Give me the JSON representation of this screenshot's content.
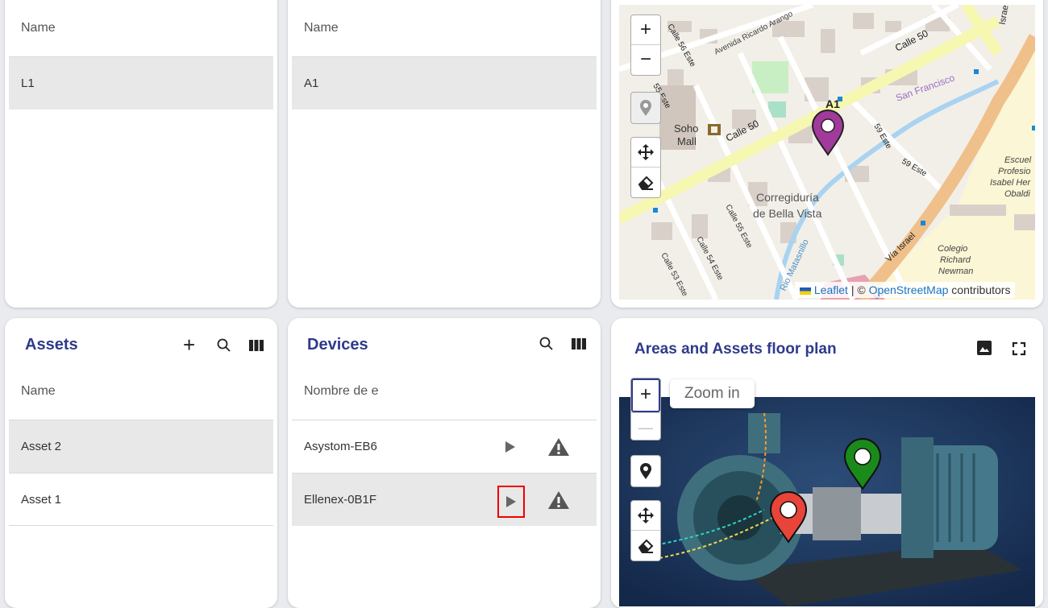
{
  "locations_card": {
    "column_header": "Name",
    "rows": [
      "L1"
    ]
  },
  "areas_card": {
    "column_header": "Name",
    "rows": [
      "A1"
    ]
  },
  "map": {
    "zoom_in": "+",
    "zoom_out": "−",
    "attribution": {
      "leaflet": "Leaflet",
      "separator": " | © ",
      "osm": "OpenStreetMap",
      "suffix": " contributors"
    },
    "labels": {
      "calle50": "Calle 50",
      "calle50_b": "Calle 50",
      "avenida": "Avenida Ricardo Arango",
      "sanfrancisco": "San Francisco",
      "soho": "Soho",
      "mall": "Mall",
      "a1": "A1",
      "correg": "Corregiduría",
      "bella": "de Bella Vista",
      "calle55": "Calle 55 Este",
      "calle54": "Calle 54 Este",
      "calle53": "Calle 53 Este",
      "rio": "Rio Matasnillo",
      "via": "Vía Israel",
      "colegio": "Colegio",
      "richard": "Richard",
      "newman": "Newman",
      "escuel": "Escuel",
      "profesio": "Profesio",
      "isabel": "Isabel Her",
      "obaldi": "Obaldi",
      "e59a": "59 Este",
      "e59b": "59 Este",
      "israel": "Israel",
      "calle56": "Calle 56 Este",
      "e55top": "55 Este",
      "co": "Co"
    },
    "colors": {
      "marker": "#a23a9b",
      "water": "#a9d3f0",
      "road_yellow": "#f6f7b0"
    }
  },
  "assets_card": {
    "title": "Assets",
    "add_icon": "+",
    "column_header": "Name",
    "rows": [
      "Asset 2",
      "Asset 1"
    ]
  },
  "devices_card": {
    "title": "Devices",
    "column_header": "Nombre de e",
    "rows": [
      {
        "name": "Asystom-EB6"
      },
      {
        "name": "Ellenex-0B1F"
      }
    ]
  },
  "floorplan_card": {
    "title": "Areas and Assets floor plan",
    "zoom_in": "+",
    "zoom_out": "—",
    "tooltip": "Zoom in",
    "colors": {
      "marker_green": "#1a8a1a",
      "marker_red": "#e8443a",
      "bg": "#1d3a5e"
    }
  }
}
